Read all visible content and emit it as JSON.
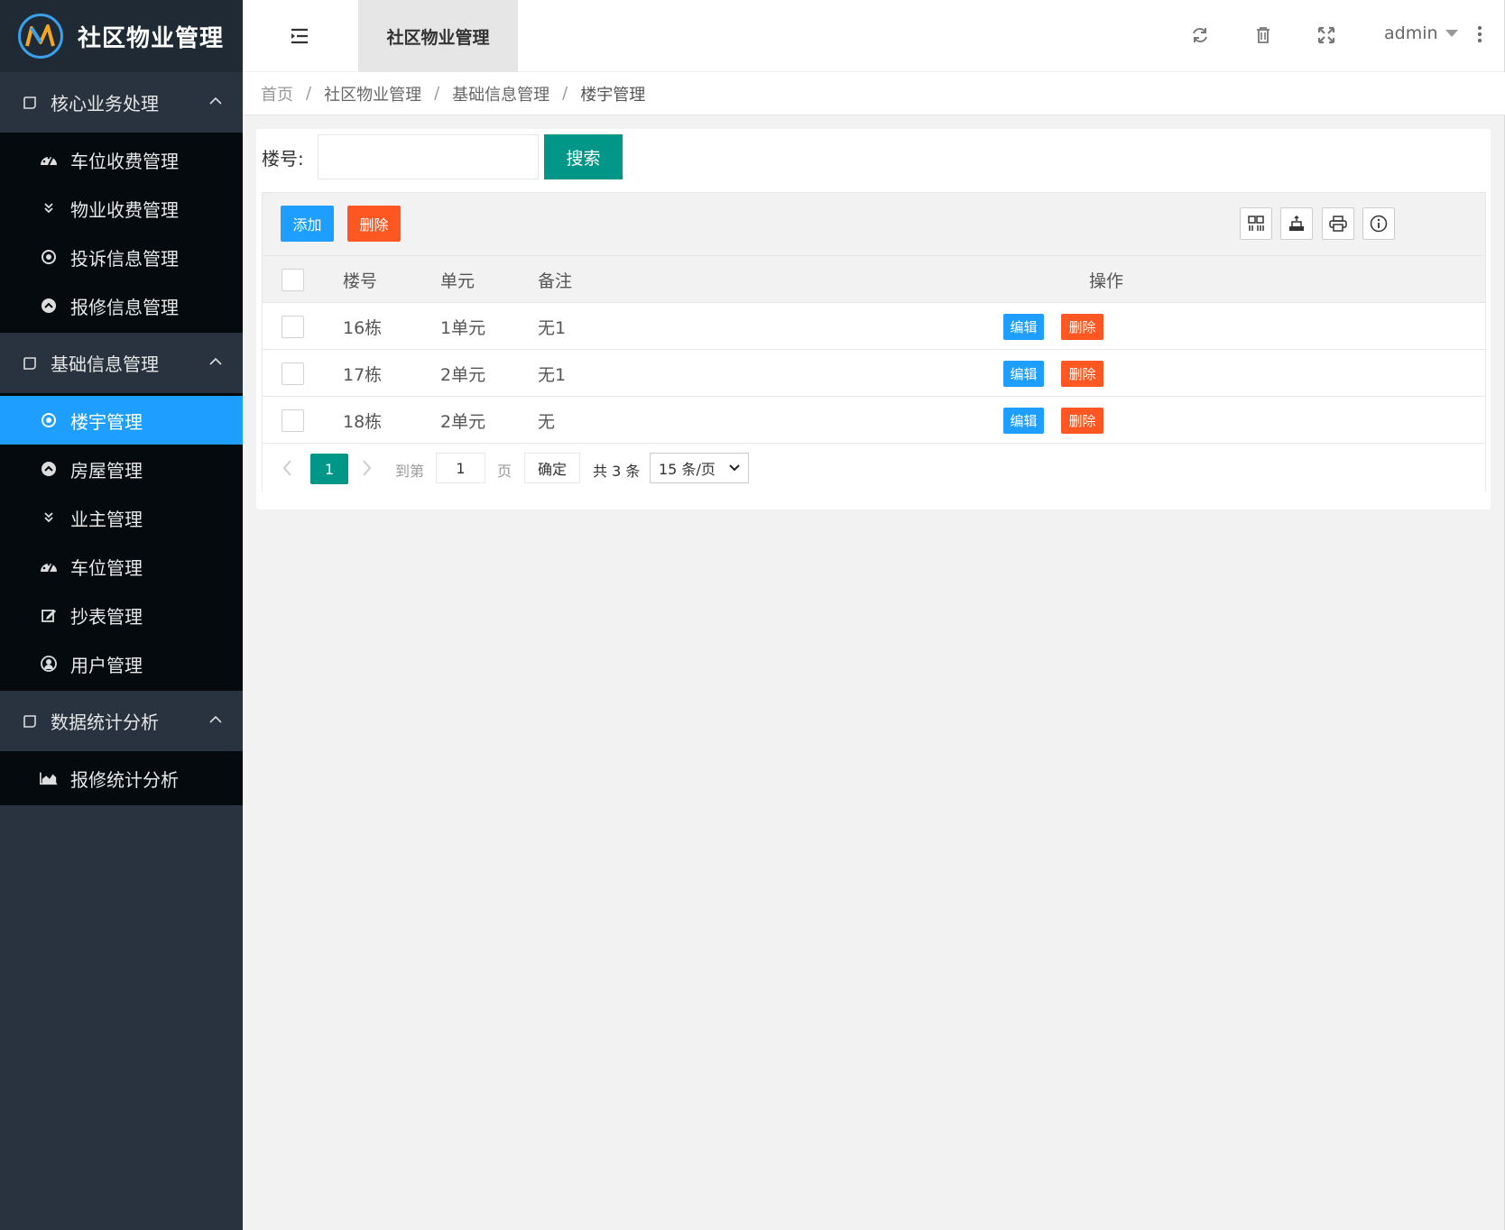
{
  "app": {
    "title": "社区物业管理",
    "brand_color": "#1e9fff",
    "teal": "#009688",
    "danger": "#ff5722"
  },
  "sidebar": {
    "groups": [
      {
        "label": "核心业务处理",
        "icon": "chat-bubble-icon",
        "expanded": true,
        "items": [
          {
            "label": "车位收费管理",
            "icon": "dashboard-icon"
          },
          {
            "label": "物业收费管理",
            "icon": "double-chevron-down-icon"
          },
          {
            "label": "投诉信息管理",
            "icon": "target-icon"
          },
          {
            "label": "报修信息管理",
            "icon": "chevron-circle-icon"
          }
        ]
      },
      {
        "label": "基础信息管理",
        "icon": "chat-bubble-icon",
        "expanded": true,
        "items": [
          {
            "label": "楼宇管理",
            "icon": "target-icon",
            "active": true
          },
          {
            "label": "房屋管理",
            "icon": "chevron-circle-icon"
          },
          {
            "label": "业主管理",
            "icon": "double-chevron-down-icon"
          },
          {
            "label": "车位管理",
            "icon": "dashboard-icon"
          },
          {
            "label": "抄表管理",
            "icon": "edit-icon"
          },
          {
            "label": "用户管理",
            "icon": "user-circle-icon"
          }
        ]
      },
      {
        "label": "数据统计分析",
        "icon": "chat-bubble-icon",
        "expanded": true,
        "items": [
          {
            "label": "报修统计分析",
            "icon": "area-chart-icon"
          }
        ]
      }
    ]
  },
  "header": {
    "tab_title": "社区物业管理",
    "user": "admin",
    "icons": [
      "refresh-icon",
      "trash-icon",
      "fullscreen-icon",
      "more-vertical-icon"
    ]
  },
  "breadcrumb": {
    "home": "首页",
    "level1": "社区物业管理",
    "level2": "基础信息管理",
    "current": "楼宇管理",
    "sep": "/"
  },
  "search": {
    "label": "楼号:",
    "value": "",
    "button": "搜索"
  },
  "toolbar": {
    "add": "添加",
    "delete": "删除",
    "right_icons": [
      "columns-icon",
      "export-icon",
      "print-icon",
      "info-icon"
    ]
  },
  "table": {
    "columns": {
      "building": "楼号",
      "unit": "单元",
      "note": "备注",
      "ops": "操作"
    },
    "rows": [
      {
        "building": "16栋",
        "unit": "1单元",
        "note": "无1",
        "edit": "编辑",
        "delete": "删除"
      },
      {
        "building": "17栋",
        "unit": "2单元",
        "note": "无1",
        "edit": "编辑",
        "delete": "删除"
      },
      {
        "building": "18栋",
        "unit": "2单元",
        "note": "无",
        "edit": "编辑",
        "delete": "删除"
      }
    ]
  },
  "pager": {
    "current": "1",
    "goto_label": "到第",
    "goto_value": "1",
    "page_label": "页",
    "ok": "确定",
    "total": "共 3 条",
    "page_size": "15 条/页"
  }
}
